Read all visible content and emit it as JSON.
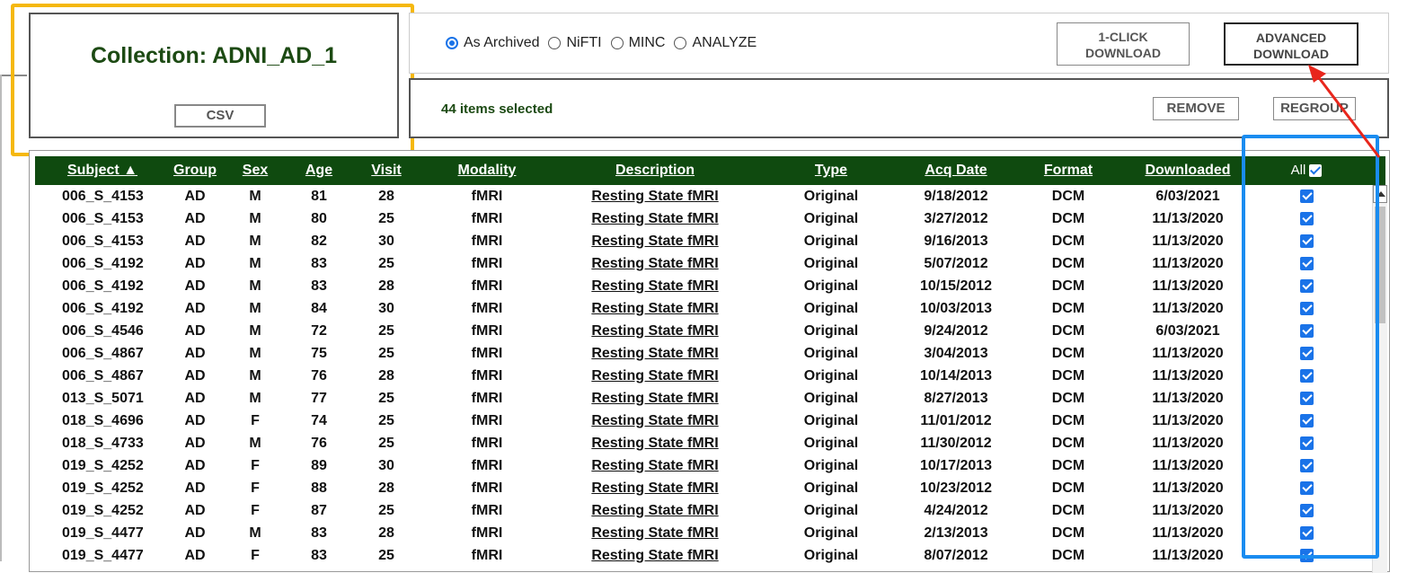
{
  "collection": {
    "title": "Collection: ADNI_AD_1",
    "csv_label": "CSV"
  },
  "format": {
    "options": [
      "As Archived",
      "NiFTI",
      "MINC",
      "ANALYZE"
    ],
    "selected": "As Archived"
  },
  "buttons": {
    "one_click_line1": "1-CLICK",
    "one_click_line2": "DOWNLOAD",
    "advanced_line1": "ADVANCED",
    "advanced_line2": "DOWNLOAD",
    "remove": "REMOVE",
    "regroup": "REGROUP"
  },
  "selection": {
    "count_text": "44 items selected"
  },
  "table": {
    "headers": {
      "subject": "Subject ▲",
      "group": "Group",
      "sex": "Sex",
      "age": "Age",
      "visit": "Visit",
      "modality": "Modality",
      "description": "Description",
      "type": "Type",
      "acq_date": "Acq Date",
      "format": "Format",
      "downloaded": "Downloaded",
      "all": "All"
    },
    "rows": [
      {
        "subject": "006_S_4153",
        "group": "AD",
        "sex": "M",
        "age": "81",
        "visit": "28",
        "modality": "fMRI",
        "description": "Resting State fMRI",
        "type": "Original",
        "acq_date": "9/18/2012",
        "format": "DCM",
        "downloaded": "6/03/2021",
        "checked": true
      },
      {
        "subject": "006_S_4153",
        "group": "AD",
        "sex": "M",
        "age": "80",
        "visit": "25",
        "modality": "fMRI",
        "description": "Resting State fMRI",
        "type": "Original",
        "acq_date": "3/27/2012",
        "format": "DCM",
        "downloaded": "11/13/2020",
        "checked": true
      },
      {
        "subject": "006_S_4153",
        "group": "AD",
        "sex": "M",
        "age": "82",
        "visit": "30",
        "modality": "fMRI",
        "description": "Resting State fMRI",
        "type": "Original",
        "acq_date": "9/16/2013",
        "format": "DCM",
        "downloaded": "11/13/2020",
        "checked": true
      },
      {
        "subject": "006_S_4192",
        "group": "AD",
        "sex": "M",
        "age": "83",
        "visit": "25",
        "modality": "fMRI",
        "description": "Resting State fMRI",
        "type": "Original",
        "acq_date": "5/07/2012",
        "format": "DCM",
        "downloaded": "11/13/2020",
        "checked": true
      },
      {
        "subject": "006_S_4192",
        "group": "AD",
        "sex": "M",
        "age": "83",
        "visit": "28",
        "modality": "fMRI",
        "description": "Resting State fMRI",
        "type": "Original",
        "acq_date": "10/15/2012",
        "format": "DCM",
        "downloaded": "11/13/2020",
        "checked": true
      },
      {
        "subject": "006_S_4192",
        "group": "AD",
        "sex": "M",
        "age": "84",
        "visit": "30",
        "modality": "fMRI",
        "description": "Resting State fMRI",
        "type": "Original",
        "acq_date": "10/03/2013",
        "format": "DCM",
        "downloaded": "11/13/2020",
        "checked": true
      },
      {
        "subject": "006_S_4546",
        "group": "AD",
        "sex": "M",
        "age": "72",
        "visit": "25",
        "modality": "fMRI",
        "description": "Resting State fMRI",
        "type": "Original",
        "acq_date": "9/24/2012",
        "format": "DCM",
        "downloaded": "6/03/2021",
        "checked": true
      },
      {
        "subject": "006_S_4867",
        "group": "AD",
        "sex": "M",
        "age": "75",
        "visit": "25",
        "modality": "fMRI",
        "description": "Resting State fMRI",
        "type": "Original",
        "acq_date": "3/04/2013",
        "format": "DCM",
        "downloaded": "11/13/2020",
        "checked": true
      },
      {
        "subject": "006_S_4867",
        "group": "AD",
        "sex": "M",
        "age": "76",
        "visit": "28",
        "modality": "fMRI",
        "description": "Resting State fMRI",
        "type": "Original",
        "acq_date": "10/14/2013",
        "format": "DCM",
        "downloaded": "11/13/2020",
        "checked": true
      },
      {
        "subject": "013_S_5071",
        "group": "AD",
        "sex": "M",
        "age": "77",
        "visit": "25",
        "modality": "fMRI",
        "description": "Resting State fMRI",
        "type": "Original",
        "acq_date": "8/27/2013",
        "format": "DCM",
        "downloaded": "11/13/2020",
        "checked": true
      },
      {
        "subject": "018_S_4696",
        "group": "AD",
        "sex": "F",
        "age": "74",
        "visit": "25",
        "modality": "fMRI",
        "description": "Resting State fMRI",
        "type": "Original",
        "acq_date": "11/01/2012",
        "format": "DCM",
        "downloaded": "11/13/2020",
        "checked": true
      },
      {
        "subject": "018_S_4733",
        "group": "AD",
        "sex": "M",
        "age": "76",
        "visit": "25",
        "modality": "fMRI",
        "description": "Resting State fMRI",
        "type": "Original",
        "acq_date": "11/30/2012",
        "format": "DCM",
        "downloaded": "11/13/2020",
        "checked": true
      },
      {
        "subject": "019_S_4252",
        "group": "AD",
        "sex": "F",
        "age": "89",
        "visit": "30",
        "modality": "fMRI",
        "description": "Resting State fMRI",
        "type": "Original",
        "acq_date": "10/17/2013",
        "format": "DCM",
        "downloaded": "11/13/2020",
        "checked": true
      },
      {
        "subject": "019_S_4252",
        "group": "AD",
        "sex": "F",
        "age": "88",
        "visit": "28",
        "modality": "fMRI",
        "description": "Resting State fMRI",
        "type": "Original",
        "acq_date": "10/23/2012",
        "format": "DCM",
        "downloaded": "11/13/2020",
        "checked": true
      },
      {
        "subject": "019_S_4252",
        "group": "AD",
        "sex": "F",
        "age": "87",
        "visit": "25",
        "modality": "fMRI",
        "description": "Resting State fMRI",
        "type": "Original",
        "acq_date": "4/24/2012",
        "format": "DCM",
        "downloaded": "11/13/2020",
        "checked": true
      },
      {
        "subject": "019_S_4477",
        "group": "AD",
        "sex": "M",
        "age": "83",
        "visit": "28",
        "modality": "fMRI",
        "description": "Resting State fMRI",
        "type": "Original",
        "acq_date": "2/13/2013",
        "format": "DCM",
        "downloaded": "11/13/2020",
        "checked": true
      },
      {
        "subject": "019_S_4477",
        "group": "AD",
        "sex": "F",
        "age": "83",
        "visit": "25",
        "modality": "fMRI",
        "description": "Resting State fMRI",
        "type": "Original",
        "acq_date": "8/07/2012",
        "format": "DCM",
        "downloaded": "11/13/2020",
        "checked": true
      }
    ]
  },
  "colors": {
    "header_green": "#0f4a0f",
    "title_green": "#1c4a13",
    "check_blue": "#1a73e8",
    "highlight_yellow": "#f5b80e",
    "highlight_blue": "#1a8cf0",
    "arrow_red": "#e8261c"
  }
}
